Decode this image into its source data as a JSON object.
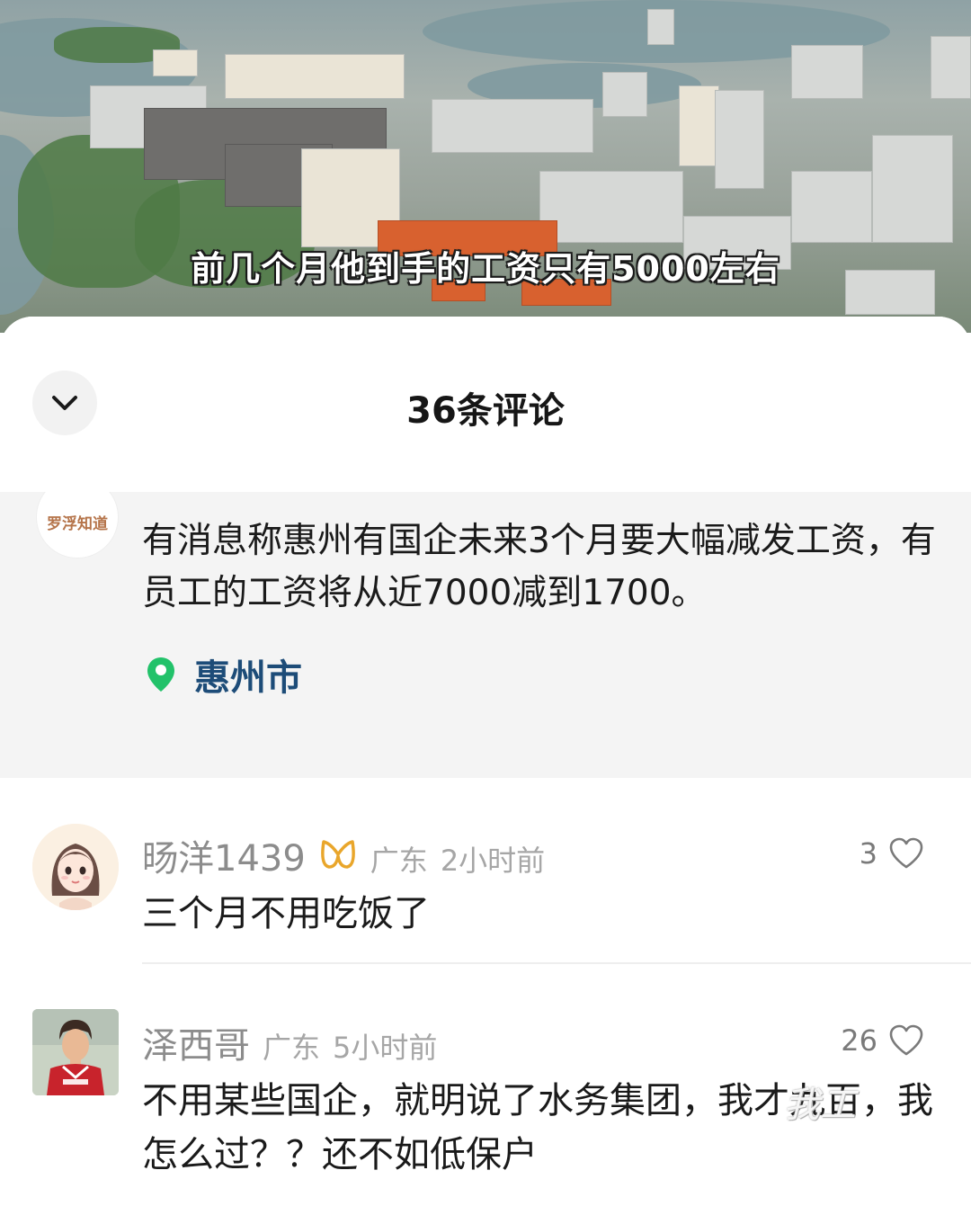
{
  "video": {
    "caption": "前几个月他到手的工资只有5000左右"
  },
  "sheet": {
    "title": "36条评论",
    "collapse_icon": "chevron-down-icon"
  },
  "post": {
    "avatar_text": "罗浮知道",
    "text": "有消息称惠州有国企未来3个月要大幅减发工资，有员工的工资将从近7000减到1700。",
    "location": "惠州市",
    "location_icon": "map-pin-icon",
    "location_icon_color": "#22c26a"
  },
  "comments": [
    {
      "user": "旸洋1439",
      "badge": "vip-badge-icon",
      "region": "广东",
      "time": "2小时前",
      "likes": "3",
      "text": "三个月不用吃饭了"
    },
    {
      "user": "泽西哥",
      "region": "广东",
      "time": "5小时前",
      "likes": "26",
      "text": "不用某些国企，就明说了水务集团，我才九百，我怎么过？？还不如低保户"
    }
  ],
  "watermark": "我工"
}
